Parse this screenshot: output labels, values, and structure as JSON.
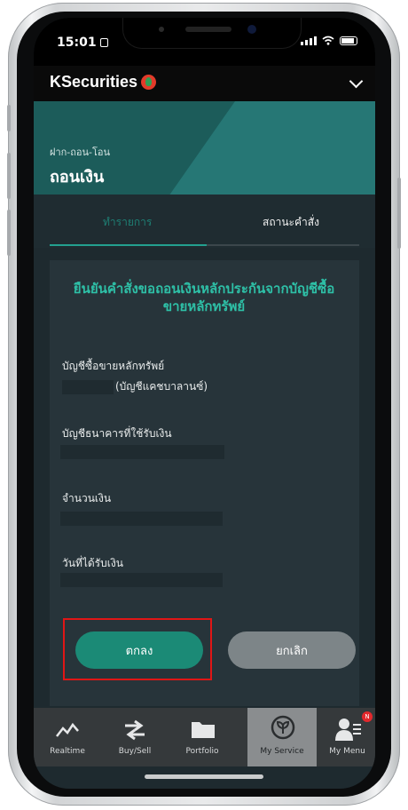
{
  "status_bar": {
    "time": "15:01"
  },
  "app_header": {
    "logo_text": "KSecurities"
  },
  "page": {
    "breadcrumb": "ฝาก-ถอน-โอน",
    "title": "ถอนเงิน"
  },
  "tabs": [
    {
      "label": "ทำรายการ"
    },
    {
      "label": "สถานะคำสั่ง"
    }
  ],
  "confirm": {
    "title": "ยืนยันคำสั่งขอถอนเงินหลักประกันจากบัญชีซื้อขายหลักทรัพย์",
    "fields": [
      {
        "label": "บัญชีซื้อขายหลักทรัพย์",
        "value_suffix": "(บัญชีแคชบาลานซ์)"
      },
      {
        "label": "บัญชีธนาคารที่ใช้รับเงิน"
      },
      {
        "label": "จำนวนเงิน"
      },
      {
        "label": "วันที่ได้รับเงิน"
      }
    ],
    "ok_label": "ตกลง",
    "cancel_label": "ยกเลิก"
  },
  "bottom_nav": [
    {
      "label": "Realtime",
      "icon": "chart-line-icon"
    },
    {
      "label": "Buy/Sell",
      "icon": "exchange-arrows-icon"
    },
    {
      "label": "Portfolio",
      "icon": "folder-icon"
    },
    {
      "label": "My Service",
      "icon": "service-icon",
      "active": true
    },
    {
      "label": "My Menu",
      "icon": "user-menu-icon",
      "badge": "N"
    }
  ],
  "colors": {
    "accent": "#1b8a76",
    "title_accent": "#2ec0a7",
    "highlight_box": "#e01616"
  }
}
